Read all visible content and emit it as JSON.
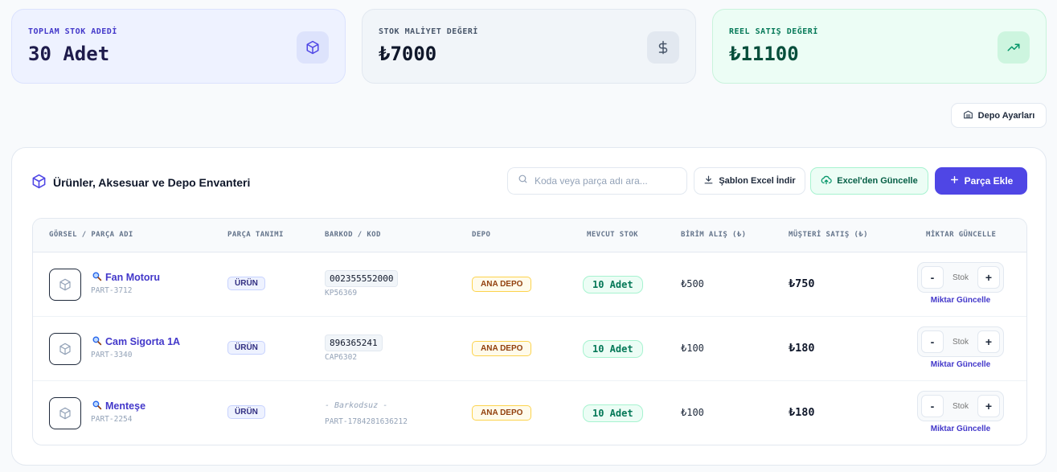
{
  "stats": {
    "total_stock": {
      "label": "TOPLAM STOK ADEDİ",
      "value": "30 Adet",
      "icon": "box-icon"
    },
    "cost_value": {
      "label": "STOK MALİYET DEĞERİ",
      "value": "₺7000",
      "icon": "dollar-icon"
    },
    "sale_value": {
      "label": "REEL SATIŞ DEĞERİ",
      "value": "₺11100",
      "icon": "trending-up-icon"
    }
  },
  "depo_settings_label": "Depo Ayarları",
  "panel": {
    "title": "Ürünler, Aksesuar ve Depo Envanteri",
    "search_placeholder": "Koda veya parça adı ara...",
    "template_button": "Şablon Excel İndir",
    "excel_update_button": "Excel'den Güncelle",
    "add_button": "Parça Ekle"
  },
  "table": {
    "headers": [
      "GÖRSEL / PARÇA ADI",
      "PARÇA TANIMI",
      "BARKOD / KOD",
      "DEPO",
      "MEVCUT STOK",
      "BİRİM ALIŞ (₺)",
      "MÜŞTERİ SATIŞ (₺)",
      "MİKTAR GÜNCELLE"
    ],
    "rows": [
      {
        "name": "Fan Motoru",
        "part": "PART-3712",
        "type": "ÜRÜN",
        "barcode": "002355552000",
        "code": "KP56369",
        "depot": "ANA DEPO",
        "stock": "10 Adet",
        "buy": "₺500",
        "sell": "₺750",
        "qty_placeholder": "Stok",
        "qty_action": "Miktar Güncelle"
      },
      {
        "name": "Cam Sigorta 1A",
        "part": "PART-3340",
        "type": "ÜRÜN",
        "barcode": "896365241",
        "code": "CAP6302",
        "depot": "ANA DEPO",
        "stock": "10 Adet",
        "buy": "₺100",
        "sell": "₺180",
        "qty_placeholder": "Stok",
        "qty_action": "Miktar Güncelle"
      },
      {
        "name": "Menteşe",
        "part": "PART-2254",
        "type": "ÜRÜN",
        "barcode": "- Barkodsuz -",
        "code": "PART-1784281636212",
        "depot": "ANA DEPO",
        "stock": "10 Adet",
        "buy": "₺100",
        "sell": "₺180",
        "qty_placeholder": "Stok",
        "qty_action": "Miktar Güncelle"
      }
    ]
  },
  "qty_minus": "-",
  "qty_plus": "+"
}
